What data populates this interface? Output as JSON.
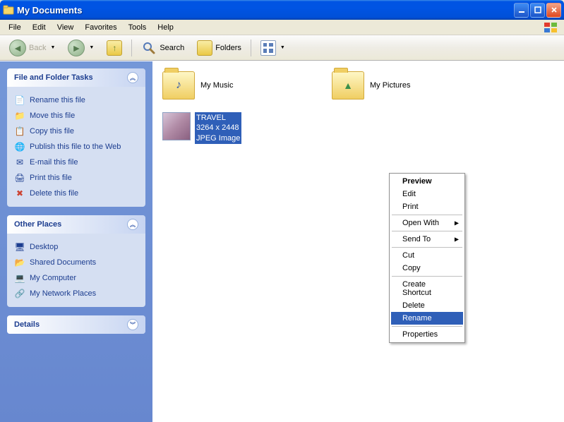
{
  "window": {
    "title": "My Documents"
  },
  "menubar": [
    "File",
    "Edit",
    "View",
    "Favorites",
    "Tools",
    "Help"
  ],
  "toolbar": {
    "back_label": "Back",
    "search_label": "Search",
    "folders_label": "Folders"
  },
  "sidebar": {
    "panels": [
      {
        "title": "File and Folder Tasks",
        "items": [
          {
            "icon": "rename-icon",
            "label": "Rename this file"
          },
          {
            "icon": "move-icon",
            "label": "Move this file"
          },
          {
            "icon": "copy-icon",
            "label": "Copy this file"
          },
          {
            "icon": "publish-icon",
            "label": "Publish this file to the Web"
          },
          {
            "icon": "email-icon",
            "label": "E-mail this file"
          },
          {
            "icon": "print-icon",
            "label": "Print this file"
          },
          {
            "icon": "delete-icon",
            "label": "Delete this file"
          }
        ]
      },
      {
        "title": "Other Places",
        "items": [
          {
            "icon": "desktop-icon",
            "label": "Desktop"
          },
          {
            "icon": "shared-icon",
            "label": "Shared Documents"
          },
          {
            "icon": "computer-icon",
            "label": "My Computer"
          },
          {
            "icon": "network-icon",
            "label": "My Network Places"
          }
        ]
      },
      {
        "title": "Details",
        "items": []
      }
    ]
  },
  "content": {
    "folders": [
      {
        "name": "My Music"
      },
      {
        "name": "My Pictures"
      }
    ],
    "selected_file": {
      "name": "TRAVEL",
      "dimensions": "3264 x 2448",
      "type": "JPEG Image"
    }
  },
  "context_menu": {
    "items": [
      {
        "label": "Preview",
        "bold": true
      },
      {
        "label": "Edit"
      },
      {
        "label": "Print"
      },
      {
        "sep": true
      },
      {
        "label": "Open With",
        "submenu": true
      },
      {
        "sep": true
      },
      {
        "label": "Send To",
        "submenu": true
      },
      {
        "sep": true
      },
      {
        "label": "Cut"
      },
      {
        "label": "Copy"
      },
      {
        "sep": true
      },
      {
        "label": "Create Shortcut"
      },
      {
        "label": "Delete"
      },
      {
        "label": "Rename",
        "highlighted": true
      },
      {
        "sep": true
      },
      {
        "label": "Properties"
      }
    ]
  }
}
